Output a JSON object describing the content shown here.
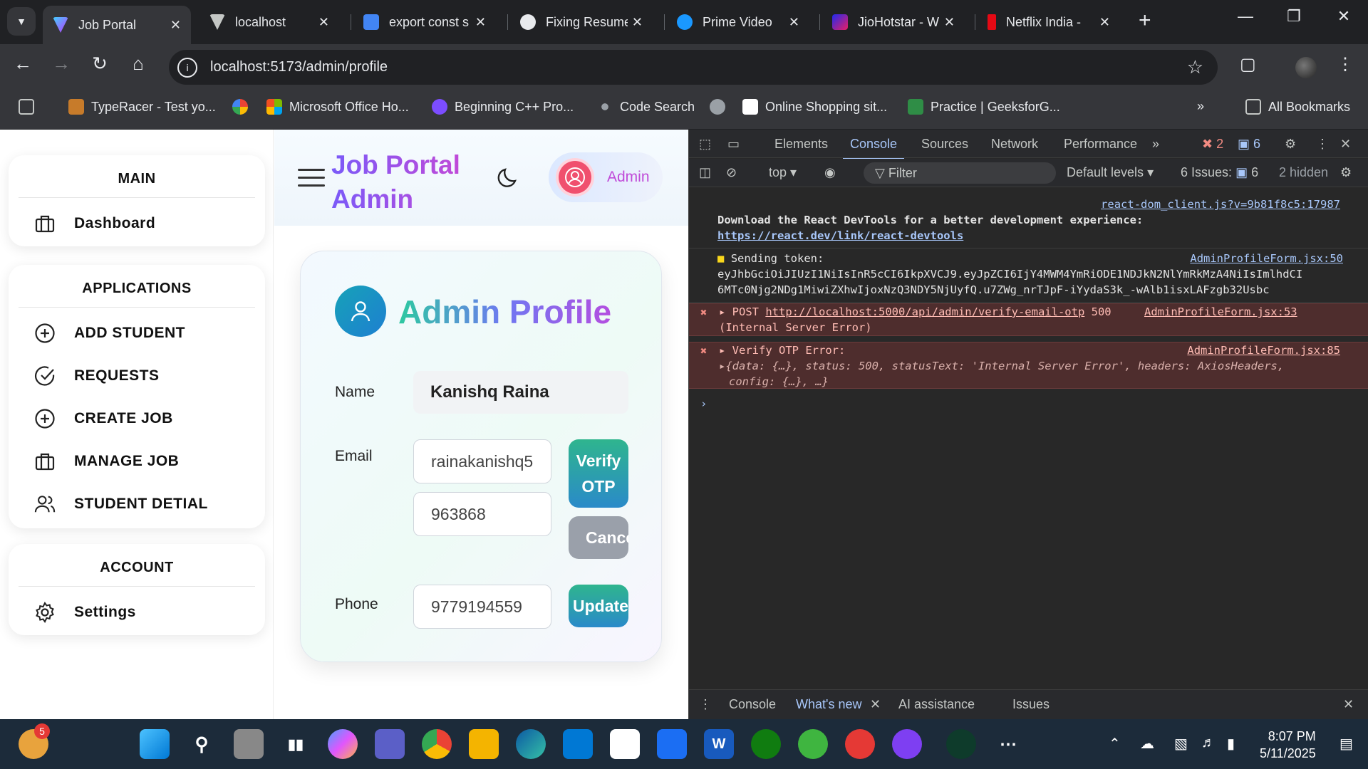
{
  "browser": {
    "tabs": [
      {
        "title": "Job Portal",
        "icon": "vite-icon",
        "color": "#a855f7",
        "active": true
      },
      {
        "title": "localhost",
        "icon": "vite-icon",
        "color": "#c4c7c5"
      },
      {
        "title": "export const s",
        "icon": "docs-icon",
        "color": "#4285f4"
      },
      {
        "title": "Fixing Resume",
        "icon": "chatgpt-icon",
        "color": "#e8eaed"
      },
      {
        "title": "Prime Video",
        "icon": "play-icon",
        "color": "#1a98ff"
      },
      {
        "title": "JioHotstar - W",
        "icon": "hotstar-icon",
        "color": "#5b2bd9"
      },
      {
        "title": "Netflix India -",
        "icon": "netflix-icon",
        "color": "#e50914"
      }
    ],
    "url": "localhost:5173/admin/profile",
    "bookmarks": [
      {
        "label": "TypeRacer - Test yo...",
        "color": "#c77b2a"
      },
      {
        "label": "",
        "color": "#ea4335"
      },
      {
        "label": "Microsoft Office Ho...",
        "color": "#f25022"
      },
      {
        "label": "Beginning C++ Pro...",
        "color": "#7c4dff"
      },
      {
        "label": "Code Search",
        "color": "#9aa0a6"
      },
      {
        "label": "",
        "color": "#9aa0a6"
      },
      {
        "label": "Online Shopping sit...",
        "color": "#ffffff"
      },
      {
        "label": "Practice | GeeksforG...",
        "color": "#2f8d46"
      }
    ],
    "all_bookmarks": "All Bookmarks"
  },
  "sidebar": {
    "main_heading": "MAIN",
    "dashboard": "Dashboard",
    "applications_heading": "APPLICATIONS",
    "add_student": "ADD STUDENT",
    "requests": "REQUESTS",
    "create_job": "CREATE JOB",
    "manage_job": "MANAGE JOB",
    "student_detail": "STUDENT DETIAL",
    "account_heading": "ACCOUNT",
    "settings": "Settings"
  },
  "header": {
    "brand_line1": "Job Portal",
    "brand_line2": "Admin",
    "admin_label": "Admin"
  },
  "profile": {
    "title": "Admin Profile",
    "name_label": "Name",
    "name_value": "Kanishq Raina",
    "email_label": "Email",
    "email_value": "rainakanishq5",
    "otp_value": "963868",
    "verify_otp": "Verify OTP",
    "cancel": "Cancel",
    "phone_label": "Phone",
    "phone_value": "9779194559",
    "update": "Update"
  },
  "devtools": {
    "tabs": [
      "Elements",
      "Console",
      "Sources",
      "Network",
      "Performance"
    ],
    "error_count": "2",
    "message_count": "6",
    "context": "top",
    "filter_placeholder": "Filter",
    "levels": "Default levels",
    "issues_label": "6 Issues:",
    "issues_count": "6",
    "hidden": "2 hidden",
    "log1_source": "react-dom_client.js?v=9b81f8c5:17987",
    "log1_text": "Download the React DevTools for a better development experience:",
    "log1_link": "https://react.dev/link/react-devtools",
    "log2_text": "Sending token:",
    "log2_source": "AdminProfileForm.jsx:50",
    "log2_token_a": "eyJhbGciOiJIUzI1NiIsInR5cCI6IkpXVCJ9.eyJpZCI6IjY4MWM4YmRiODE1NDJkN2NlYmRkMzA4NiIsImlhdCI",
    "log2_token_b": "6MTc0Njg2NDg1MiwiZXhwIjoxNzQ3NDY5NjUyfQ.u7ZWg_nrTJpF-iYydaS3k_-wAlb1isxLAFzgb32Usbc",
    "log3_method": "POST",
    "log3_url": "http://localhost:5000/api/admin/verify-email-otp",
    "log3_status": "500",
    "log3_source": "AdminProfileForm.jsx:53",
    "log3_text": "(Internal Server Error)",
    "log4_title": "Verify OTP Error:",
    "log4_source": "AdminProfileForm.jsx:85",
    "log4_a": "{data: {…}, status: 500, statusText: 'Internal Server Error', headers: AxiosHeaders,",
    "log4_b": "config: {…}, …}",
    "drawer_tabs": [
      "Console",
      "What's new",
      "AI assistance",
      "Issues"
    ]
  },
  "taskbar": {
    "badge": "5",
    "time": "8:07 PM",
    "date": "5/11/2025"
  }
}
